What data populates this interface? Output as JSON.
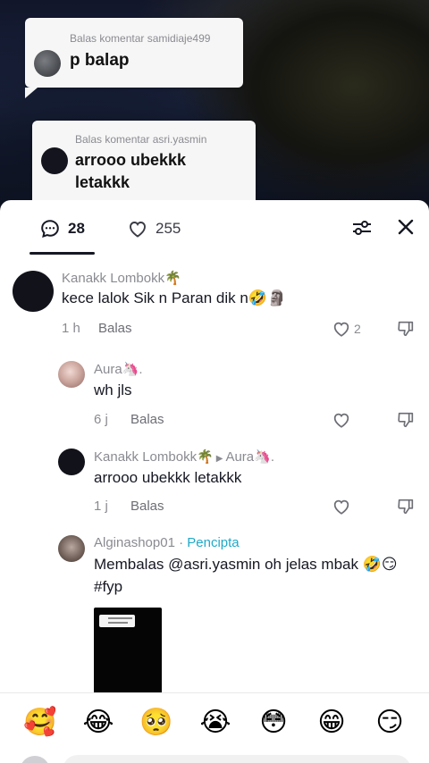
{
  "stickers": [
    {
      "label": "Balas komentar samidiaje499",
      "text": "p balap"
    },
    {
      "label": "Balas komentar asri.yasmin",
      "text": "arrooo ubekkk letakkk"
    }
  ],
  "header": {
    "comments_count": "28",
    "likes_count": "255",
    "filter_icon": "sliders-icon",
    "close_icon": "close-icon"
  },
  "comments": [
    {
      "name": "Kanakk Lombokk🌴",
      "text": "kece lalok Sik n Paran dik n🤣🗿",
      "time": "1 h",
      "reply": "Balas",
      "likes": "2"
    },
    {
      "name": "Aura🦄.",
      "text": "wh jls",
      "time": "6 j",
      "reply": "Balas",
      "likes": ""
    },
    {
      "name": "Kanakk Lombokk🌴",
      "reply_to": "Aura🦄.",
      "text": "arrooo ubekkk letakkk",
      "time": "1 j",
      "reply": "Balas",
      "likes": ""
    },
    {
      "name": "Alginashop01",
      "creator_badge": "Pencipta",
      "text": "Membalas @asri.yasmin oh jelas mbak 🤣😏#fyp"
    }
  ],
  "emojis": [
    "🥰",
    "😂",
    "🥺",
    "😭",
    "😳",
    "😁",
    "😏"
  ],
  "colors": {
    "creator": "#20a9c8",
    "muted": "#8a8b91",
    "text": "#161823"
  }
}
